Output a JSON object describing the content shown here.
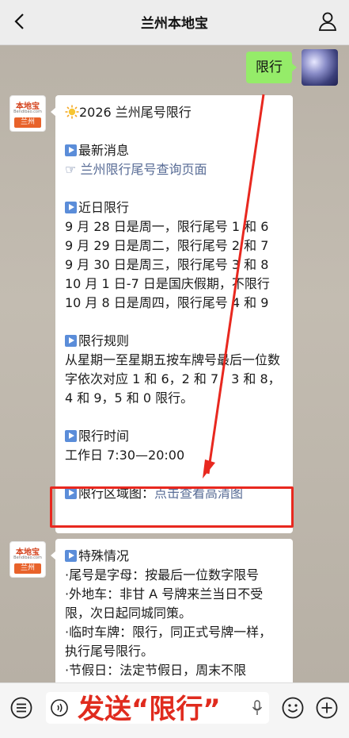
{
  "header": {
    "title": "兰州本地宝"
  },
  "my_message": {
    "text": "限行"
  },
  "bot": {
    "avatar_top": "本地宝",
    "avatar_mid": "Bendibao.com",
    "avatar_city": "兰州"
  },
  "card1": {
    "title": "2026 兰州尾号限行",
    "news_heading": "最新消息",
    "news_link_prefix": "☞ ",
    "news_link": "兰州限行尾号查询页面",
    "recent_heading": "近日限行",
    "recent_lines": [
      "9 月 28 日是周一，限行尾号 1 和 6",
      "9 月 29 日是周二，限行尾号 2 和 7",
      "9 月 30 日是周三，限行尾号 3 和 8",
      "10 月 1 日-7 日是国庆假期，不限行",
      "10 月 8 日是周四，限行尾号 4 和 9"
    ],
    "rules_heading": "限行规则",
    "rules_text": "从星期一至星期五按车牌号最后一位数字依次对应 1 和 6，2 和 7，3 和 8，4 和 9，5 和 0 限行。",
    "time_heading": "限行时间",
    "time_text": "工作日 7:30—20:00",
    "area_heading": "限行区域图：",
    "area_link": "点击查看高清图"
  },
  "card2": {
    "special_heading": "特殊情况",
    "lines": [
      "·尾号是字母：按最后一位数字限号",
      "·外地车：非甘 A 号牌来兰当日不受限，次日起同城同策。",
      "·临时车牌：限行，同正式号牌一样，执行尾号限行。",
      "·节假日：法定节假日，周末不限"
    ]
  },
  "input": {
    "caption": "发送“限行”"
  },
  "icons": [
    "back-icon",
    "user-icon",
    "sun-icon",
    "play-square-icon",
    "menu-icon",
    "voice-icon",
    "mic-icon",
    "emoji-icon",
    "plus-icon"
  ],
  "colors": {
    "accent_red": "#e8281f",
    "bubble_green": "#95ec69",
    "link_blue": "#576b95"
  }
}
